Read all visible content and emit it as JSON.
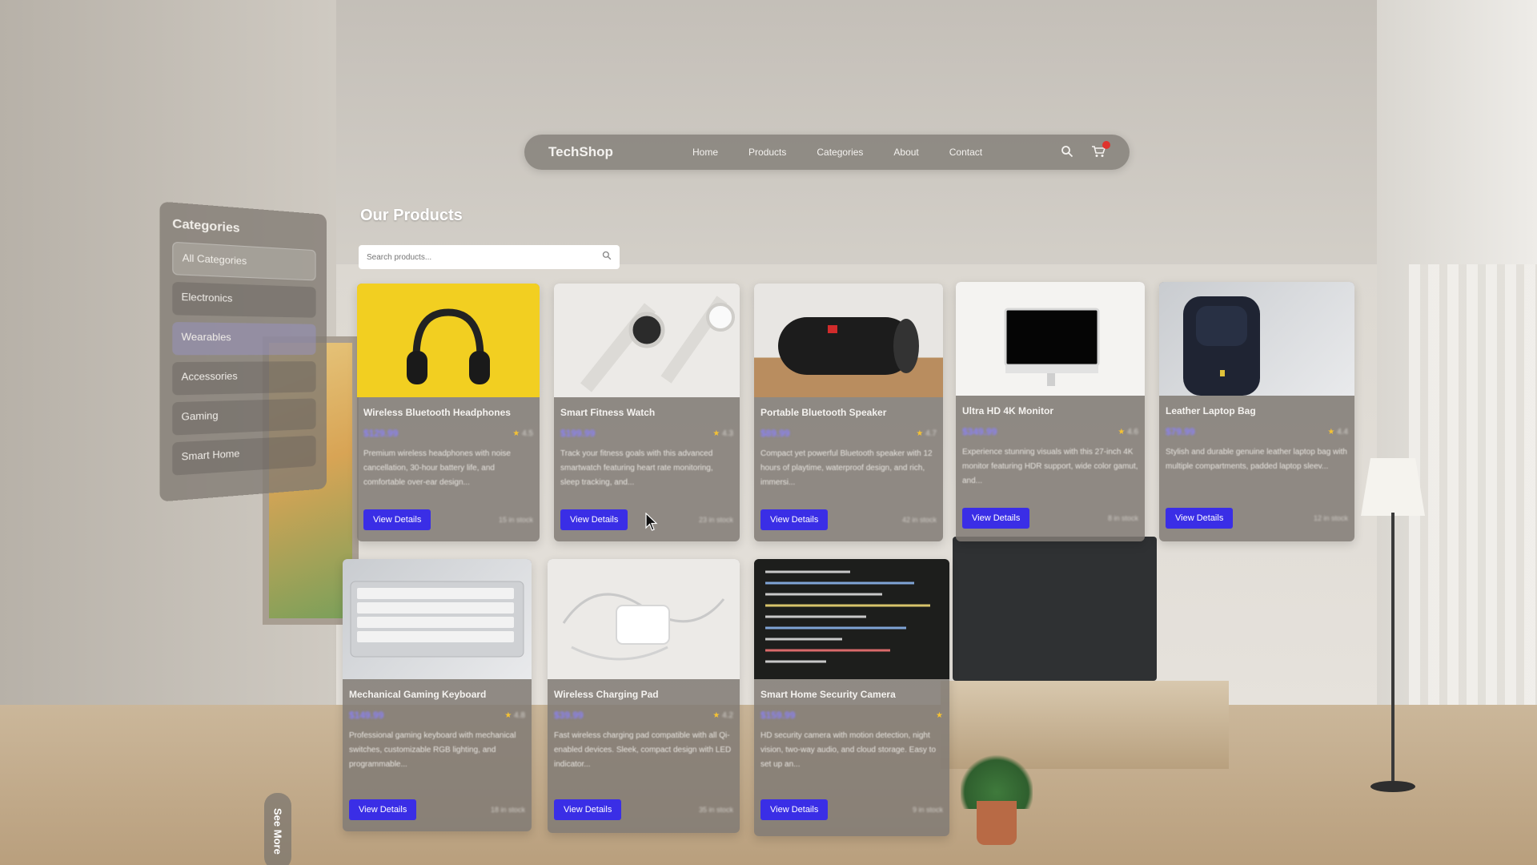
{
  "nav": {
    "brand": "TechShop",
    "links": [
      "Home",
      "Products",
      "Categories",
      "About",
      "Contact"
    ]
  },
  "categories": {
    "title": "Categories",
    "items": [
      "All Categories",
      "Electronics",
      "Wearables",
      "Accessories",
      "Gaming",
      "Smart Home"
    ]
  },
  "main": {
    "title": "Our Products",
    "search_placeholder": "Search products..."
  },
  "products": [
    {
      "name": "Wireless Bluetooth Headphones",
      "button": "View Details"
    },
    {
      "name": "Smart Fitness Watch",
      "button": "View Details"
    },
    {
      "name": "Portable Bluetooth Speaker",
      "button": "View Details"
    },
    {
      "name": "Ultra HD 4K Monitor",
      "button": "View Details"
    },
    {
      "name": "Leather Laptop Bag",
      "button": "View Details"
    },
    {
      "name": "Mechanical Gaming Keyboard",
      "button": "View Details"
    },
    {
      "name": "Wireless Charging Pad",
      "button": "View Details"
    },
    {
      "name": "Smart Home Security Camera",
      "button": "View Details"
    }
  ],
  "see_more": "See More",
  "colors": {
    "accent": "#3a2ee6",
    "price": "#8a80ff",
    "star": "#f5c233",
    "cart_badge": "#e0332d"
  }
}
